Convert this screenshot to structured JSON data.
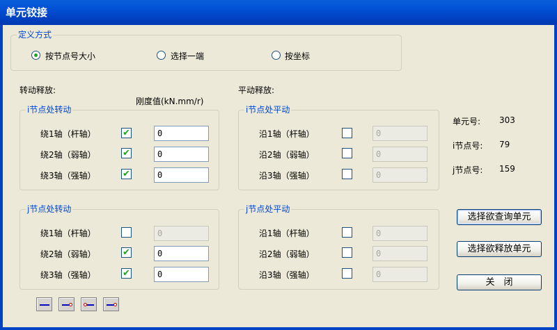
{
  "window": {
    "title": "单元铰接"
  },
  "define_method": {
    "title": "定义方式",
    "options": [
      {
        "label": "按节点号大小",
        "selected": true
      },
      {
        "label": "选择一端",
        "selected": false
      },
      {
        "label": "按坐标",
        "selected": false
      }
    ]
  },
  "rotation_label": "转动释放:",
  "translation_label": "平动释放:",
  "stiffness_label": "刚度值(kN.mm/r)",
  "groups": {
    "i_rot": {
      "title": "i节点处转动",
      "rows": [
        {
          "label": "绕1轴（杆轴）",
          "checked": true,
          "value": "0"
        },
        {
          "label": "绕2轴（弱轴）",
          "checked": true,
          "value": "0"
        },
        {
          "label": "绕3轴（强轴）",
          "checked": true,
          "value": "0"
        }
      ]
    },
    "i_trans": {
      "title": "i节点处平动",
      "rows": [
        {
          "label": "沿1轴（杆轴）",
          "checked": false,
          "value": "0"
        },
        {
          "label": "沿2轴（弱轴）",
          "checked": false,
          "value": "0"
        },
        {
          "label": "沿3轴（强轴）",
          "checked": false,
          "value": "0"
        }
      ]
    },
    "j_rot": {
      "title": "j节点处转动",
      "rows": [
        {
          "label": "绕1轴（杆轴）",
          "checked": false,
          "value": "0"
        },
        {
          "label": "绕2轴（弱轴）",
          "checked": true,
          "value": "0"
        },
        {
          "label": "绕3轴（强轴）",
          "checked": true,
          "value": "0"
        }
      ]
    },
    "j_trans": {
      "title": "j节点处平动",
      "rows": [
        {
          "label": "沿1轴（杆轴）",
          "checked": false,
          "value": "0"
        },
        {
          "label": "沿2轴（弱轴）",
          "checked": false,
          "value": "0"
        },
        {
          "label": "沿3轴（强轴）",
          "checked": false,
          "value": "0"
        }
      ]
    }
  },
  "info": {
    "element_label": "单元号:",
    "element_value": "303",
    "i_node_label": "i节点号:",
    "i_node_value": "79",
    "j_node_label": "j节点号:",
    "j_node_value": "159"
  },
  "buttons": {
    "query": "选择欲查询单元",
    "release": "选择欲释放单元",
    "close": "关　闭"
  },
  "colors": {
    "title_bar": "#0353d6",
    "group_title": "#0046d5",
    "check": "#21a121"
  }
}
